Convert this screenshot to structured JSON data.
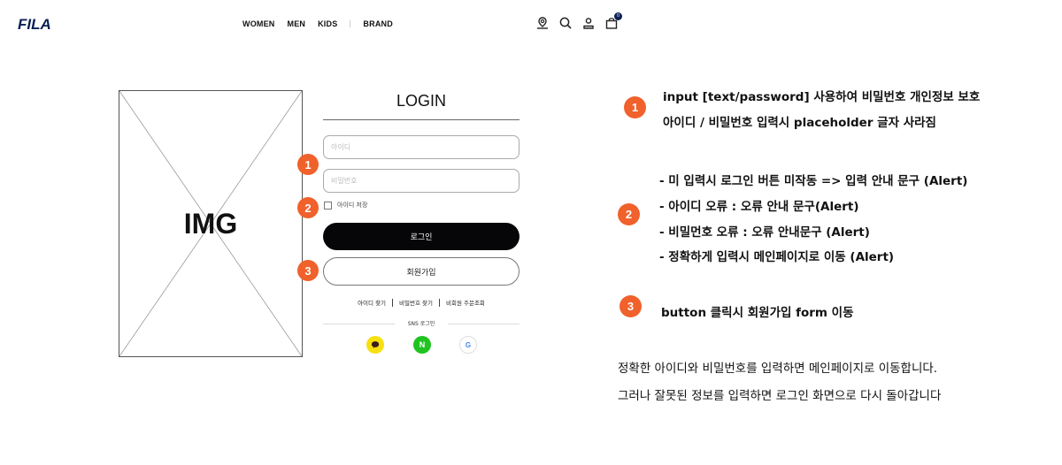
{
  "header": {
    "logo_text": "FILA",
    "brand_color": "#0c2054",
    "nav": [
      "WOMEN",
      "MEN",
      "KIDS",
      "BRAND"
    ],
    "icons": [
      "store-locator-icon",
      "search-icon",
      "user-icon",
      "cart-icon"
    ],
    "cart_count": "0"
  },
  "wireframe": {
    "image_placeholder_label": "IMG"
  },
  "login": {
    "title": "LOGIN",
    "id_placeholder": "아이디",
    "pw_placeholder": "비밀번호",
    "save_id_label": "아이디 저장",
    "login_button": "로그인",
    "join_button": "회원가입",
    "links": [
      "아이디 찾기",
      "비밀번호 찾기",
      "비회원 주문조회"
    ],
    "sns_label": "SNS 로그인",
    "sns": [
      "kakao",
      "naver",
      "google"
    ],
    "naver_letter": "N",
    "google_letter": "G"
  },
  "markers": [
    "1",
    "2",
    "3"
  ],
  "marker_color": "#f0612b",
  "annotations": {
    "note1": [
      "input [text/password] 사용하여 비밀번호 개인정보 보호",
      "아이디 / 비밀번호 입력시 placeholder 글자 사라짐"
    ],
    "note2": [
      "- 미 입력시 로그인 버튼 미작동 => 입력 안내 문구 (Alert)",
      "- 아이디 오류 : 오류 안내 문구(Alert)",
      "- 비밀먼호 오류 : 오류 안내문구 (Alert)",
      "- 정확하게 입력시 메인페이지로 이동 (Alert)"
    ],
    "note3": "button 클릭시 회원가입 form 이동",
    "summary": [
      "정확한 아이디와 비밀번호를 입력하면 메인페이지로 이동합니다.",
      "그러나 잘못된 정보를 입력하면 로그인 화면으로 다시 돌아갑니다"
    ]
  }
}
